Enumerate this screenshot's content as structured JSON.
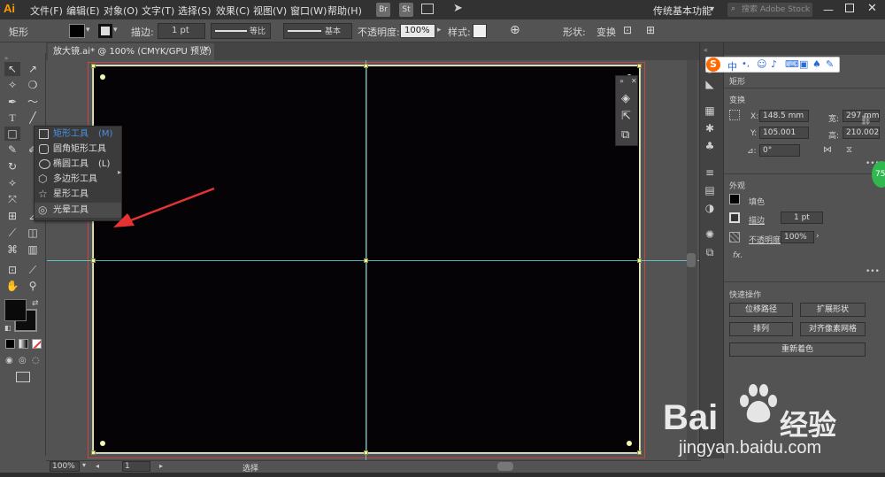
{
  "app": {
    "logo": "Ai",
    "workspace": "传统基本功能",
    "search_placeholder": "搜索 Adobe Stock",
    "bridge": "Br",
    "stock": "St"
  },
  "menu": [
    "文件(F)",
    "编辑(E)",
    "对象(O)",
    "文字(T)",
    "选择(S)",
    "效果(C)",
    "视图(V)",
    "窗口(W)",
    "帮助(H)"
  ],
  "control": {
    "selection_type": "矩形",
    "stroke_label": "描边:",
    "stroke_value": "1 pt",
    "stroke_profile": "等比",
    "brush": "基本",
    "opacity_label": "不透明度:",
    "opacity_value": "100%",
    "style_label": "样式:",
    "shape_label": "形状:",
    "transform_label": "变换"
  },
  "document": {
    "tab": "放大镜.ai* @ 100% (CMYK/GPU 预览)",
    "close": "×"
  },
  "flyout": {
    "items": [
      {
        "label": "矩形工具",
        "shortcut": "(M)"
      },
      {
        "label": "圆角矩形工具",
        "shortcut": ""
      },
      {
        "label": "椭圆工具",
        "shortcut": "(L)"
      },
      {
        "label": "多边形工具",
        "shortcut": ""
      },
      {
        "label": "星形工具",
        "shortcut": ""
      },
      {
        "label": "光晕工具",
        "shortcut": ""
      }
    ]
  },
  "ime": {
    "logo": "S",
    "mode": "中",
    "punct": "•,"
  },
  "props": {
    "title": "矩形",
    "transform_title": "变换",
    "x_label": "X:",
    "x_value": "148.5 mm",
    "y_label": "Y:",
    "y_value": "105.001",
    "w_label": "宽:",
    "w_value": "297 mm",
    "h_label": "高:",
    "h_value": "210.002",
    "angle_label": "⊿:",
    "angle_value": "0°",
    "appearance_title": "外观",
    "fill_label": "填色",
    "stroke_label": "描边",
    "stroke_value": "1 pt",
    "opacity_label": "不透明度",
    "opacity_value": "100%",
    "fx": "fx.",
    "quick_actions_title": "快速操作",
    "btn_offset_path": "位移路径",
    "btn_expand_shape": "扩展形状",
    "btn_arrange": "排列",
    "btn_align_pixel": "对齐像素网格",
    "btn_recolor": "重新着色"
  },
  "status": {
    "zoom": "100%",
    "artboard": "1",
    "tool": "选择"
  },
  "watermark": {
    "brand": "Bai",
    "brand2": "经验",
    "url": "jingyan.baidu.com"
  },
  "bubble": "75",
  "colors": {
    "menubar": "#323232",
    "panel": "#535353",
    "artboard": "#060306",
    "guide": "#5fd3d8",
    "bleed": "#c24747",
    "arrow": "#e53333",
    "highlight": "#4a90e2"
  }
}
